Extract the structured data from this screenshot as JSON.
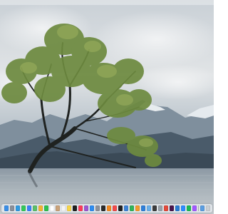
{
  "desktop": {
    "wallpaper": "lone-tree-in-lake",
    "dock": {
      "apps": [
        {
          "icon": "finder-icon",
          "color": "#3a8ee6"
        },
        {
          "icon": "launchpad-icon",
          "color": "#8a8f99"
        },
        {
          "icon": "safari-icon",
          "color": "#2f9ae0"
        },
        {
          "icon": "messages-icon",
          "color": "#35c759"
        },
        {
          "icon": "mail-icon",
          "color": "#3b82f6"
        },
        {
          "icon": "maps-icon",
          "color": "#5bbf6a"
        },
        {
          "icon": "photos-icon",
          "color": "#f2b233"
        },
        {
          "icon": "facetime-icon",
          "color": "#30c04f"
        },
        {
          "icon": "calendar-icon",
          "color": "#ffffff"
        },
        {
          "icon": "contacts-icon",
          "color": "#c9a27a"
        },
        {
          "icon": "reminders-icon",
          "color": "#f5f5f5"
        },
        {
          "icon": "notes-icon",
          "color": "#f7d54a"
        },
        {
          "icon": "tv-icon",
          "color": "#1f1f1f"
        },
        {
          "icon": "music-icon",
          "color": "#fb3c5a"
        },
        {
          "icon": "podcasts-icon",
          "color": "#9b59d0"
        },
        {
          "icon": "app-store-icon",
          "color": "#2d8cf0"
        },
        {
          "icon": "settings-icon",
          "color": "#8d9199"
        },
        {
          "icon": "terminal-icon",
          "color": "#2b2b2b"
        },
        {
          "icon": "books-icon",
          "color": "#f08a24"
        },
        {
          "icon": "news-icon",
          "color": "#f24b4b"
        },
        {
          "icon": "stocks-icon",
          "color": "#222222"
        },
        {
          "icon": "keynote-icon",
          "color": "#3e84d6"
        },
        {
          "icon": "numbers-icon",
          "color": "#31b45a"
        },
        {
          "icon": "pages-icon",
          "color": "#f29a2e"
        },
        {
          "icon": "xcode-icon",
          "color": "#2f7fd8"
        },
        {
          "icon": "preview-icon",
          "color": "#6cb0e8"
        },
        {
          "icon": "activity-monitor-icon",
          "color": "#3c3c3c"
        },
        {
          "icon": "disk-utility-icon",
          "color": "#9aa1a8"
        },
        {
          "icon": "chrome-icon",
          "color": "#e24a3b"
        },
        {
          "icon": "slack-icon",
          "color": "#4a154b"
        },
        {
          "icon": "vscode-icon",
          "color": "#2a7bd0"
        },
        {
          "icon": "zoom-icon",
          "color": "#2d8cff"
        },
        {
          "icon": "spotify-icon",
          "color": "#1db954"
        },
        {
          "icon": "figma-icon",
          "color": "#a259ff"
        }
      ],
      "extras": [
        {
          "icon": "downloads-icon",
          "color": "#5a9de0"
        },
        {
          "icon": "trash-icon",
          "color": "#c9ced3"
        }
      ]
    }
  }
}
